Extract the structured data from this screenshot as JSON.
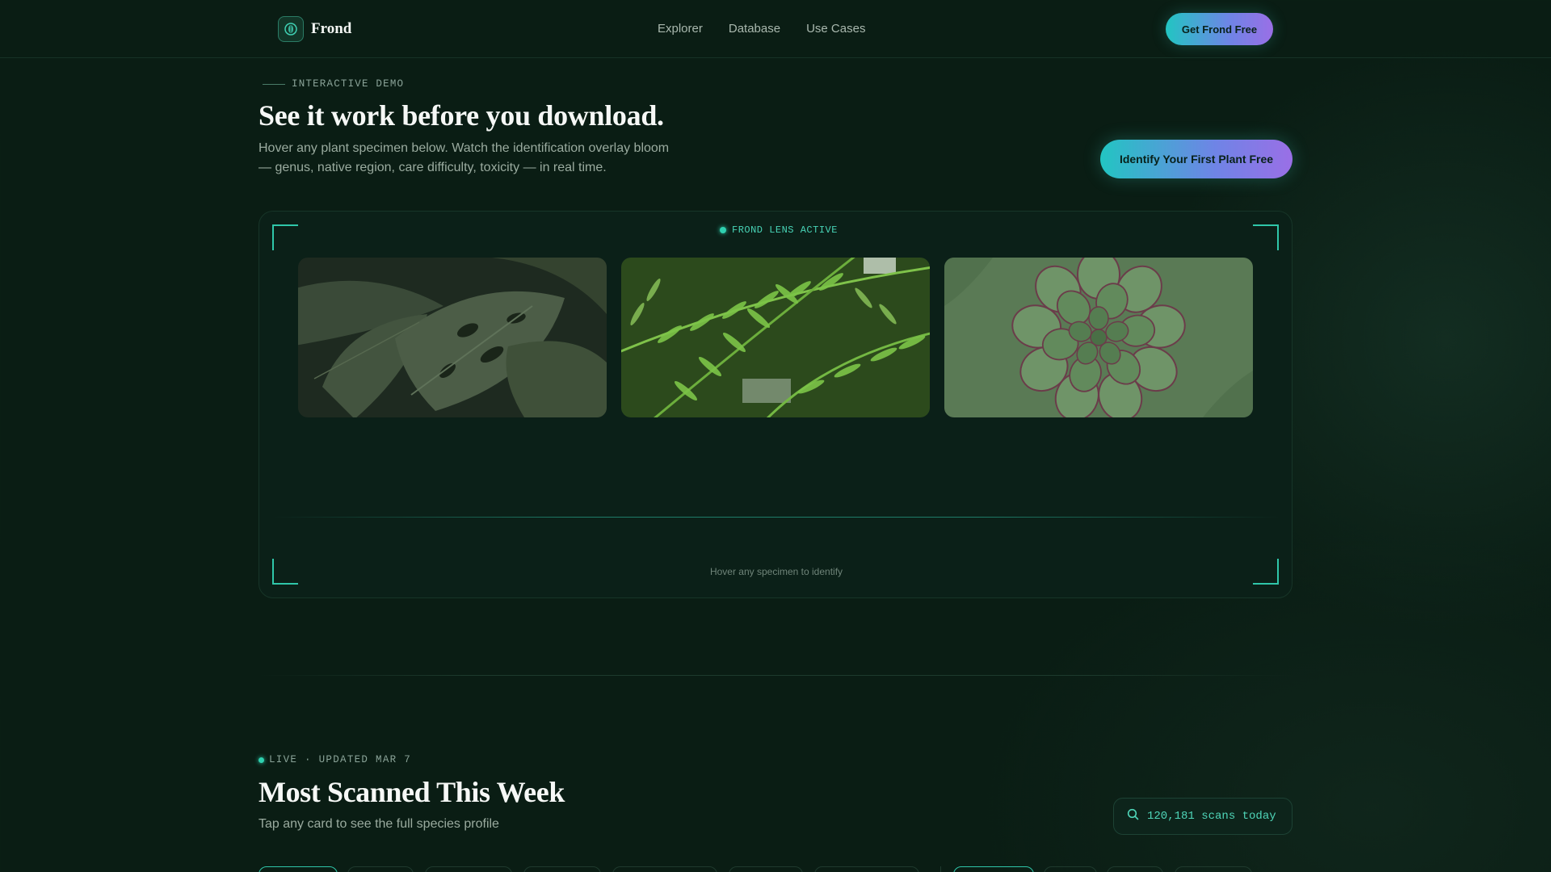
{
  "nav": {
    "brand": "Frond",
    "links": [
      "Explorer",
      "Database",
      "Use Cases"
    ],
    "cta": "Get Frond Free"
  },
  "demo": {
    "eyebrow": "INTERACTIVE DEMO",
    "title": "See it work before you download.",
    "subtitle": "Hover any plant specimen below. Watch the identification overlay bloom — genus, native region, care difficulty, toxicity — in real time.",
    "cta": "Identify Your First Plant Free",
    "lens_status": "FROND LENS ACTIVE",
    "specimens": [
      "monstera",
      "fern",
      "succulent"
    ],
    "hint": "Hover any specimen to identify"
  },
  "scanned": {
    "live_label": "LIVE · UPDATED MAR 7",
    "title": "Most Scanned This Week",
    "subtitle": "Tap any card to see the full species profile",
    "counter": "120,181 scans today"
  },
  "colors": {
    "background": "#0a1d14",
    "accent": "#2fc6a9",
    "gradient_start": "#22c5c2",
    "gradient_end": "#9a6fe6"
  },
  "icons": {
    "logo": "leaf-logo-icon",
    "counter": "search-icon"
  }
}
